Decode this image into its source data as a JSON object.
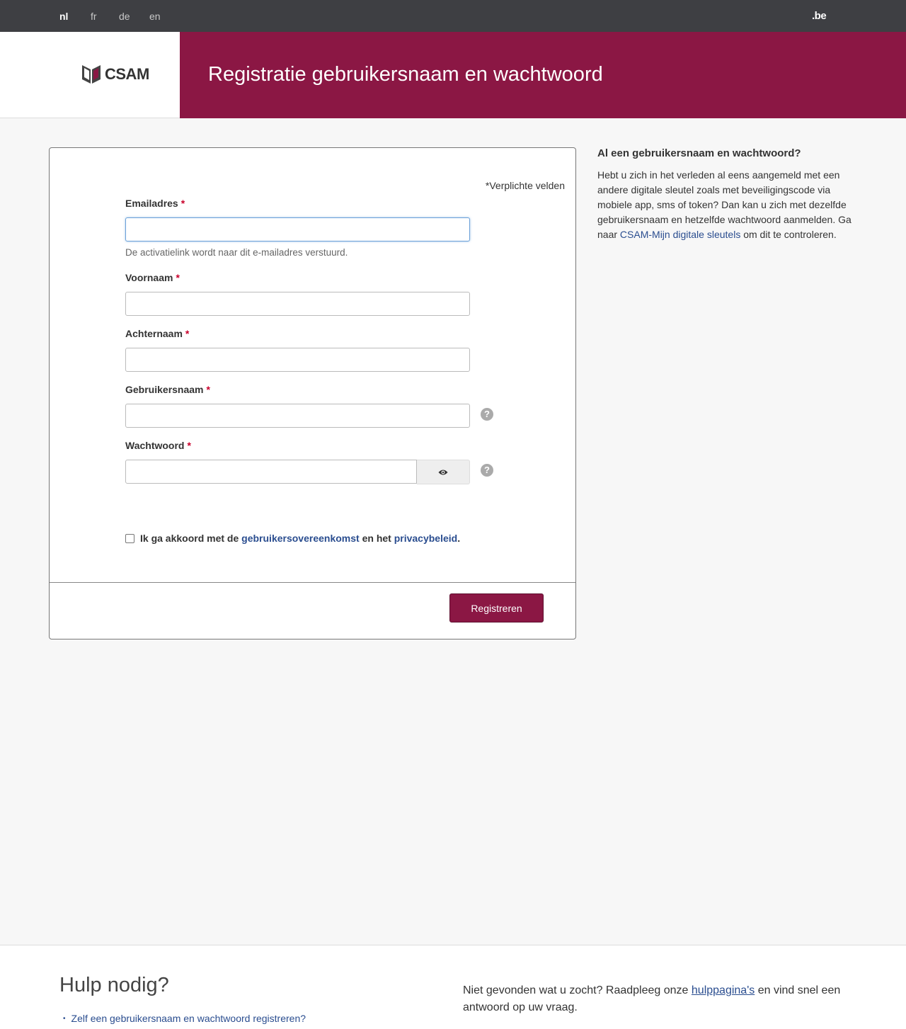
{
  "topbar": {
    "languages": [
      "nl",
      "fr",
      "de",
      "en"
    ],
    "active_language": "nl",
    "brand": ".be"
  },
  "header": {
    "logo_text": "CSAM",
    "title": "Registratie gebruikersnaam en wachtwoord"
  },
  "form": {
    "required_note": "*Verplichte velden",
    "required_marker": "*",
    "fields": {
      "email": {
        "label": "Emailadres",
        "value": "",
        "help": "De activatielink wordt naar dit e-mailadres verstuurd."
      },
      "firstname": {
        "label": "Voornaam",
        "value": ""
      },
      "lastname": {
        "label": "Achternaam",
        "value": ""
      },
      "username": {
        "label": "Gebruikersnaam",
        "value": ""
      },
      "password": {
        "label": "Wachtwoord",
        "value": ""
      }
    },
    "help_icon": "?",
    "agreement": {
      "prefix": "Ik ga akkoord met de",
      "link1": "gebruikersovereenkomst",
      "middle": "en het",
      "link2": "privacybeleid",
      "suffix": ".",
      "checked": false
    },
    "submit_label": "Registreren"
  },
  "aside": {
    "title": "Al een gebruikersnaam en wachtwoord?",
    "text_before": "Hebt u zich in het verleden al eens aangemeld met een andere digitale sleutel zoals met beveiligingscode via mobiele app, sms of token? Dan kan u zich met dezelfde gebruikersnaam en hetzelfde wachtwoord aanmelden. Ga naar",
    "link": "CSAM-Mijn digitale sleutels",
    "text_after": "om dit te controleren."
  },
  "footer": {
    "title": "Hulp nodig?",
    "bullet": "•",
    "help_link": "Zelf een gebruikersnaam en wachtwoord registreren?",
    "text_before": "Niet gevonden wat u zocht? Raadpleeg onze",
    "link": "hulppagina's",
    "text_after": "en vind snel een antwoord op uw vraag."
  },
  "colors": {
    "brand": "#8b1744",
    "topbar": "#3e3f43",
    "link": "#2a4d8f"
  }
}
